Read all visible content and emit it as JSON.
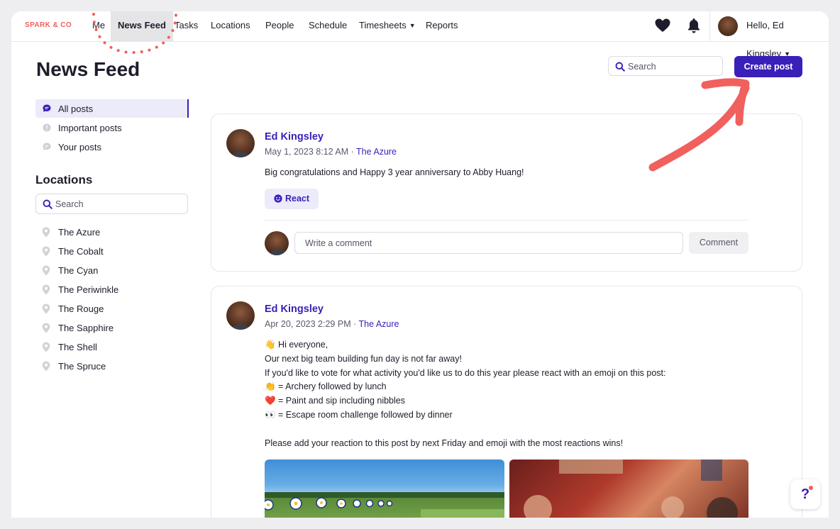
{
  "brand": "SPARK & CO",
  "nav": {
    "items": [
      {
        "label": "Me"
      },
      {
        "label": "News Feed"
      },
      {
        "label": "Tasks"
      },
      {
        "label": "Locations"
      },
      {
        "label": "People"
      },
      {
        "label": "Schedule"
      },
      {
        "label": "Timesheets"
      },
      {
        "label": "Reports"
      }
    ],
    "active": "News Feed",
    "greeting": "Hello, Ed Kingsley"
  },
  "page": {
    "title": "News Feed",
    "search_placeholder": "Search",
    "create_label": "Create post"
  },
  "sidebar": {
    "filters": [
      {
        "label": "All posts",
        "active": true
      },
      {
        "label": "Important posts",
        "active": false
      },
      {
        "label": "Your posts",
        "active": false
      }
    ],
    "locations_heading": "Locations",
    "search_placeholder": "Search",
    "locations": [
      {
        "label": "The Azure"
      },
      {
        "label": "The Cobalt"
      },
      {
        "label": "The Cyan"
      },
      {
        "label": "The Periwinkle"
      },
      {
        "label": "The Rouge"
      },
      {
        "label": "The Sapphire"
      },
      {
        "label": "The Shell"
      },
      {
        "label": "The Spruce"
      }
    ]
  },
  "posts": [
    {
      "author": "Ed Kingsley",
      "datetime": "May 1, 2023 8:12 AM",
      "location": "The Azure",
      "text": "Big congratulations and Happy 3 year anniversary to Abby Huang!",
      "react_label": "React",
      "comment_placeholder": "Write a comment",
      "comment_button": "Comment"
    },
    {
      "author": "Ed Kingsley",
      "datetime": "Apr 20, 2023 2:29 PM",
      "location": "The Azure",
      "lines": [
        "👋 Hi everyone,",
        "Our next big team building fun day is not far away!",
        "If you'd like to vote for what activity you'd like us to do this year please react with an emoji on this post:",
        "👏 = Archery followed by lunch",
        "❤️ = Paint and sip including nibbles",
        "👀 = Escape room challenge followed by dinner",
        "",
        "Please add your reaction to this post by next Friday and emoji with the most reactions wins!"
      ]
    }
  ],
  "colors": {
    "accent": "#3a1fb8",
    "brand": "#f0605d",
    "annotation": "#f0605d"
  },
  "icons": {
    "favorites": "heart-icon",
    "notifications": "bell-icon",
    "help": "help-icon"
  },
  "help_label": "?"
}
